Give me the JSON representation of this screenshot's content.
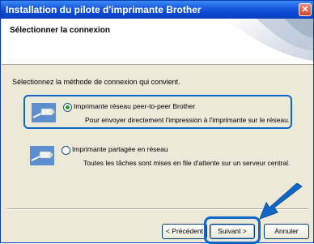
{
  "window": {
    "title": "Installation du pilote d'imprimante Brother"
  },
  "header": {
    "title": "Sélectionner la connexion"
  },
  "instruction": "Sélectionnez la méthode de connexion qui convient.",
  "options": [
    {
      "label": "Imprimante réseau peer-to-peer Brother",
      "description": "Pour envoyer directement l'impression à l'imprimante sur le réseau.",
      "selected": true
    },
    {
      "label": "Imprimante partagée en réseau",
      "description": "Toutes les tâches sont mises en file d'attente sur un serveur central.",
      "selected": false
    }
  ],
  "buttons": {
    "back": "< Précédent",
    "next": "Suivant >",
    "cancel": "Annuler"
  },
  "colors": {
    "highlight": "#1167c8",
    "titlebar": "#0b48d0"
  },
  "icons": [
    "network-cable-icon",
    "close-icon",
    "arrow-pointer-icon"
  ]
}
